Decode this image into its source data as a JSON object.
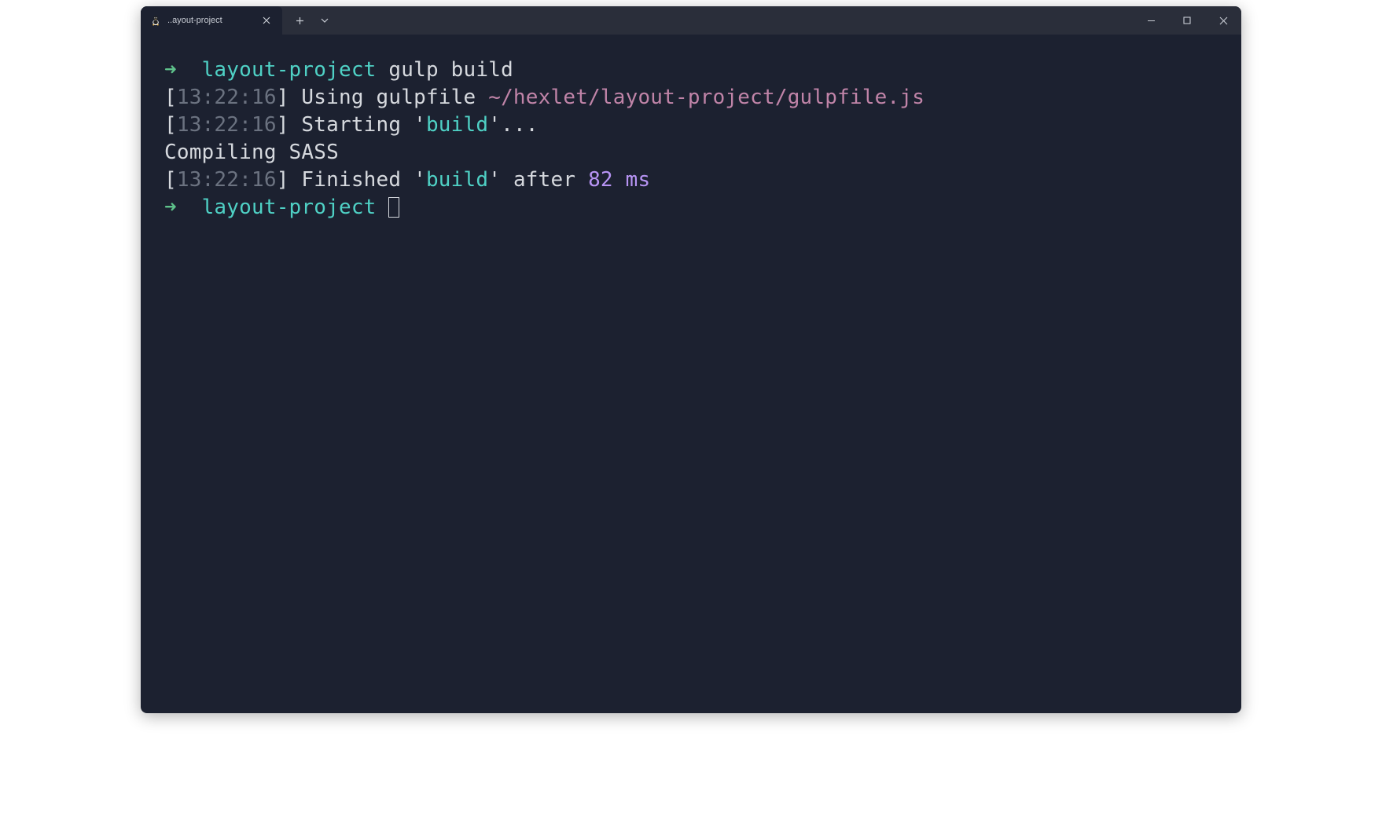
{
  "titlebar": {
    "tab_title": "..ayout-project"
  },
  "prompt": {
    "arrow": "➜",
    "directory": "layout-project",
    "command": "gulp build"
  },
  "lines": {
    "l1": {
      "time": "13:22:16",
      "text_a": "Using gulpfile ",
      "path": "~/hexlet/layout-project/gulpfile.js"
    },
    "l2": {
      "time": "13:22:16",
      "text_a": "Starting '",
      "task": "build",
      "text_b": "'..."
    },
    "l3": {
      "text": "Compiling SASS"
    },
    "l4": {
      "time": "13:22:16",
      "text_a": "Finished '",
      "task": "build",
      "text_b": "' after ",
      "num": "82 ms"
    }
  }
}
